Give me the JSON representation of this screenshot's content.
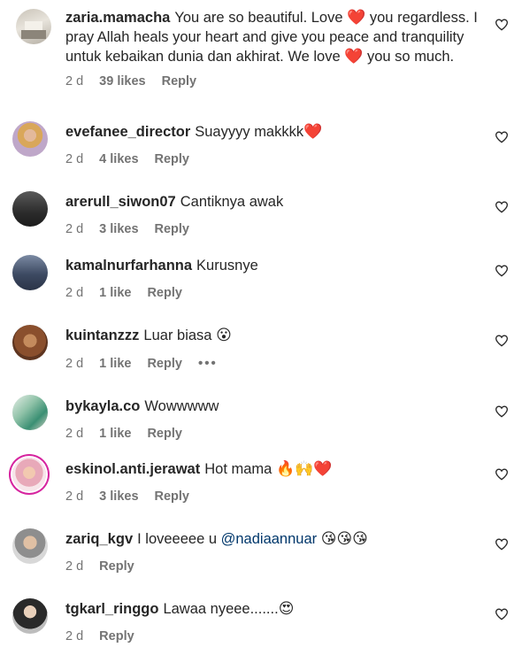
{
  "colors": {
    "text": "#262626",
    "meta": "#737373",
    "mention": "#00376b",
    "heart_emoji": "#e0245e"
  },
  "comments": [
    {
      "username": "zaria.mamacha",
      "segments": [
        "You are so beautiful. Love ",
        "❤️",
        " you regardless. I pray Allah heals your heart and give you peace and tranquility untuk kebaikan dunia dan akhirat. We love ",
        "❤️",
        " you so much."
      ],
      "time": "2 d",
      "likes": "39 likes",
      "reply": "Reply",
      "avatar_icon": "avatar-photo-icon",
      "like_icon": "heart-outline-icon"
    },
    {
      "username": "evefanee_director",
      "text": "Suayyyy makkkk",
      "emoji": "❤️",
      "time": "2 d",
      "likes": "4 likes",
      "reply": "Reply"
    },
    {
      "username": "arerull_siwon07",
      "text": "Cantiknya awak",
      "time": "2 d",
      "likes": "3 likes",
      "reply": "Reply"
    },
    {
      "username": "kamalnurfarhanna",
      "text": "Kurusnye",
      "time": "2 d",
      "likes": "1 like",
      "reply": "Reply"
    },
    {
      "username": "kuintanzzz",
      "text": "Luar biasa",
      "emoji": "😮",
      "time": "2 d",
      "likes": "1 like",
      "reply": "Reply",
      "more": "•••"
    },
    {
      "username": "bykayla.co",
      "text": "Wowwwww",
      "time": "2 d",
      "likes": "1 like",
      "reply": "Reply"
    },
    {
      "username": "eskinol.anti.jerawat",
      "text": "Hot mama",
      "emoji": "🔥🙌❤️",
      "time": "2 d",
      "likes": "3 likes",
      "reply": "Reply"
    },
    {
      "username": "zariq_kgv",
      "text": "I loveeeee u",
      "mention": "@nadiaannuar",
      "emoji": "😘😘😘",
      "time": "2 d",
      "reply": "Reply"
    },
    {
      "username": "tgkarl_ringgo",
      "text": "Lawaa nyeee.......",
      "emoji": "😍",
      "time": "2 d",
      "reply": "Reply"
    }
  ]
}
